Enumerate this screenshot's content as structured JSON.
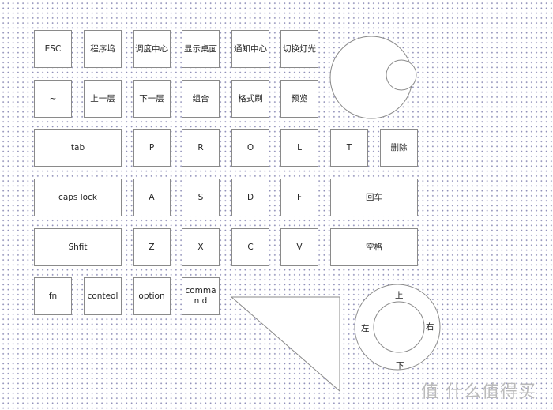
{
  "rows": [
    [
      "ESC",
      "程序坞",
      "调度中心",
      "显示桌面",
      "通知中心",
      "切换灯光"
    ],
    [
      "~",
      "上一层",
      "下一层",
      "组合",
      "格式刷",
      "预览"
    ],
    [
      "tab",
      "P",
      "R",
      "O",
      "L",
      "T",
      "删除"
    ],
    [
      "caps lock",
      "A",
      "S",
      "D",
      "F",
      "回车"
    ],
    [
      "Shfit",
      "Z",
      "X",
      "C",
      "V",
      "空格"
    ],
    [
      "fn",
      "conteol",
      "option",
      "comman d"
    ]
  ],
  "dpad": {
    "up": "上",
    "down": "下",
    "left": "左",
    "right": "右"
  },
  "watermark": "值 什么值得买",
  "colors": {
    "outline": "#8a8a8a",
    "dots": "#8f8fb8"
  }
}
